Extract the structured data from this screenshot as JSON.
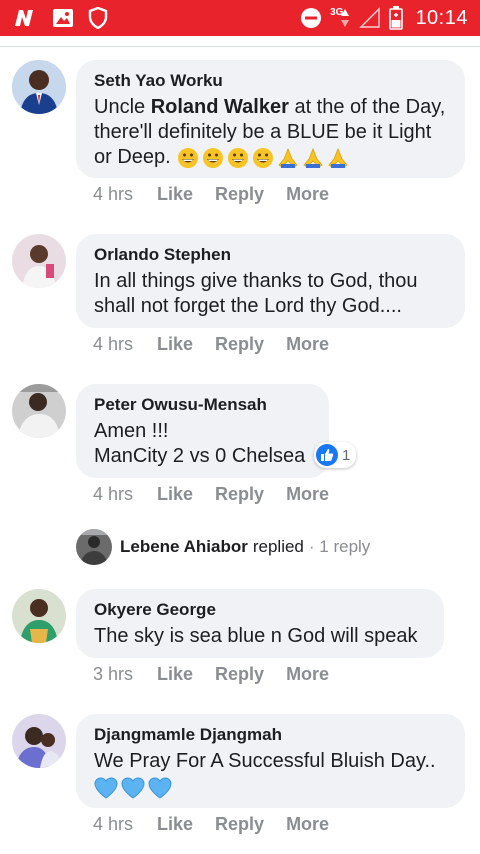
{
  "status_bar": {
    "app_icons": [
      "news-app-icon",
      "gallery-icon",
      "shield-icon"
    ],
    "network_label": "3G",
    "time": "10:14"
  },
  "comments": [
    {
      "author": "Seth Yao Worku",
      "text_before": "Uncle ",
      "text_bold": "Roland Walker",
      "text_after": " at the of the Day, there'll definitely be a BLUE be it Light or Deep.",
      "emojis": [
        "grinning-face",
        "grinning-face",
        "grinning-face",
        "grinning-face",
        "folded-hands",
        "folded-hands",
        "folded-hands"
      ],
      "time": "4 hrs",
      "like": "Like",
      "reply": "Reply",
      "more": "More"
    },
    {
      "author": "Orlando Stephen",
      "text": "In all things give thanks to God, thou shall not forget the Lord thy God....",
      "time": "4 hrs",
      "like": "Like",
      "reply": "Reply",
      "more": "More"
    },
    {
      "author": "Peter Owusu-Mensah",
      "line1": "Amen !!!",
      "line2": "ManCity 2 vs 0 Chelsea",
      "reaction_count": "1",
      "time": "4 hrs",
      "like": "Like",
      "reply": "Reply",
      "more": "More",
      "replies": {
        "name": "Lebene Ahiabor",
        "verb": "replied",
        "count": "· 1 reply"
      }
    },
    {
      "author": "Okyere George",
      "text": "The sky is sea blue n God will speak",
      "time": "3 hrs",
      "like": "Like",
      "reply": "Reply",
      "more": "More"
    },
    {
      "author": "Djangmamle Djangmah",
      "text": "We Pray For A Successful Bluish Day..",
      "emojis": [
        "blue-heart",
        "blue-heart",
        "blue-heart"
      ],
      "time": "4 hrs",
      "like": "Like",
      "reply": "Reply",
      "more": "More"
    }
  ],
  "colors": {
    "status_bar": "#e8232b",
    "bubble": "#f0f2f5",
    "meta_text": "#8a8d91",
    "like_blue": "#1877f2",
    "emoji_yellow": "#f7c325",
    "heart_blue": "#5cb3f2"
  }
}
